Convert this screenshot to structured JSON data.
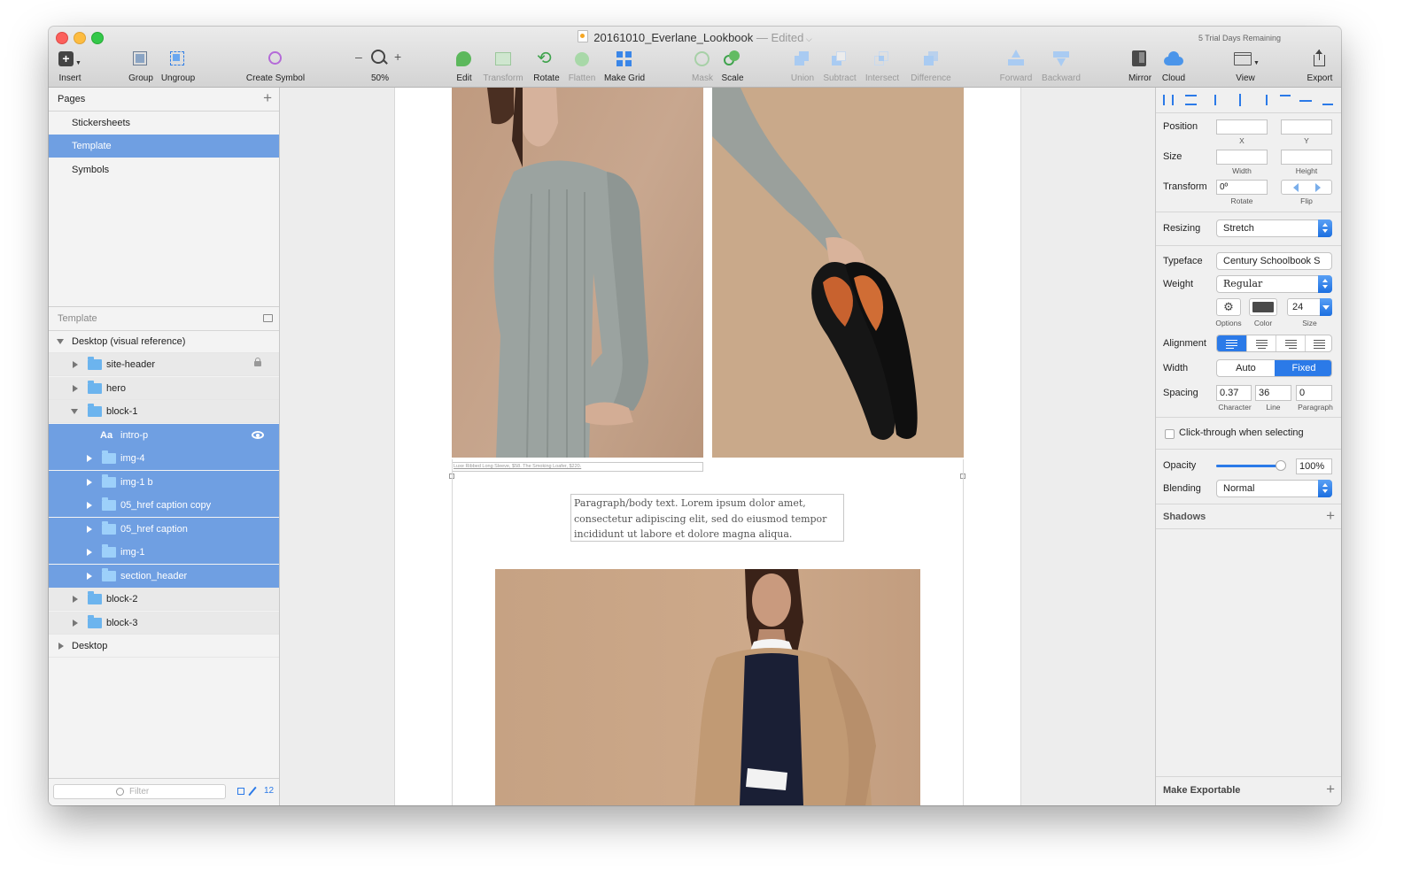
{
  "window": {
    "title": "20161010_Everlane_Lookbook",
    "edited": "— Edited",
    "trial": "5 Trial Days Remaining"
  },
  "toolbar": {
    "insert": "Insert",
    "group": "Group",
    "ungroup": "Ungroup",
    "create_symbol": "Create Symbol",
    "zoom_minus": "–",
    "zoom_plus": "+",
    "zoom": "50%",
    "edit": "Edit",
    "transform": "Transform",
    "rotate": "Rotate",
    "flatten": "Flatten",
    "make_grid": "Make Grid",
    "mask": "Mask",
    "scale": "Scale",
    "union": "Union",
    "subtract": "Subtract",
    "intersect": "Intersect",
    "difference": "Difference",
    "forward": "Forward",
    "backward": "Backward",
    "mirror": "Mirror",
    "cloud": "Cloud",
    "view": "View",
    "export": "Export"
  },
  "pages": {
    "header": "Pages",
    "add": "+",
    "items": [
      "Stickersheets",
      "Template",
      "Symbols"
    ],
    "selected": "Template"
  },
  "layers": {
    "header": "Template",
    "items": [
      {
        "label": "Desktop (visual reference)"
      },
      {
        "label": "site-header"
      },
      {
        "label": "hero"
      },
      {
        "label": "block-1"
      },
      {
        "label": "intro-p",
        "prefix": "Aa"
      },
      {
        "label": "img-4"
      },
      {
        "label": "img-1 b"
      },
      {
        "label": "05_href caption copy"
      },
      {
        "label": "05_href caption"
      },
      {
        "label": "img-1"
      },
      {
        "label": "section_header"
      },
      {
        "label": "block-2"
      },
      {
        "label": "block-3"
      },
      {
        "label": "Desktop"
      }
    ],
    "filter_placeholder": "Filter",
    "count": "12"
  },
  "canvas": {
    "caption": "Luxe Ribbed Long Sleeve, $58. The Smoking Loafer, $220.",
    "paragraph": "Paragraph/body text. Lorem ipsum dolor amet, consectetur adipiscing elit, sed do eiusmod tempor incididunt ut labore et dolore magna aliqua."
  },
  "inspector": {
    "position_label": "Position",
    "x_label": "X",
    "y_label": "Y",
    "size_label": "Size",
    "width_sub": "Width",
    "height_sub": "Height",
    "transform_label": "Transform",
    "rotate_value": "0º",
    "rotate_sub": "Rotate",
    "flip_sub": "Flip",
    "resizing_label": "Resizing",
    "resizing_value": "Stretch",
    "typeface_label": "Typeface",
    "typeface_value": "Century Schoolbook S",
    "weight_label": "Weight",
    "weight_value": "Regular",
    "options_sub": "Options",
    "color_sub": "Color",
    "size_value": "24",
    "size_sub": "Size",
    "alignment_label": "Alignment",
    "width_label": "Width",
    "width_auto": "Auto",
    "width_fixed": "Fixed",
    "spacing_label": "Spacing",
    "character_value": "0.37",
    "line_value": "36",
    "paragraph_value": "0",
    "character_sub": "Character",
    "line_sub": "Line",
    "paragraph_sub": "Paragraph",
    "click_through": "Click-through when selecting",
    "opacity_label": "Opacity",
    "opacity_value": "100%",
    "opacity_level": 1.0,
    "blending_label": "Blending",
    "blending_value": "Normal",
    "shadows_label": "Shadows",
    "make_exportable": "Make Exportable",
    "add": "+"
  },
  "colors": {
    "selection": "#6f9fe2",
    "accent_blue": "#2b7ae8",
    "folder": "#6cb4ee",
    "photo_bg": "#c9a98a"
  }
}
